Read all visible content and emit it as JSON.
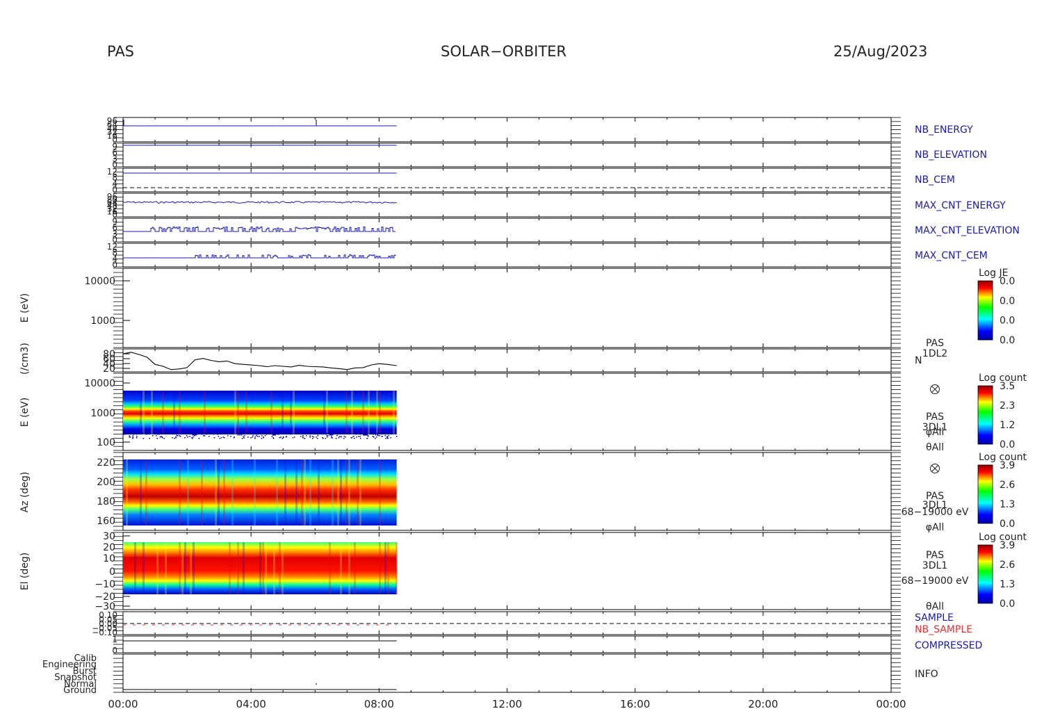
{
  "header": {
    "left": "PAS",
    "center": "SOLAR−ORBITER",
    "right": "25/Aug/2023"
  },
  "colors": {
    "blue_trace": "#1a1aa8",
    "red_trace": "#e53030",
    "black": "#000000"
  },
  "x_axis": {
    "ticks": [
      "00:00",
      "04:00",
      "08:00",
      "12:00",
      "16:00",
      "20:00",
      "00:00"
    ],
    "range_hours": [
      0,
      24
    ],
    "data_end_hours": 8.55
  },
  "strip_labels": {
    "nb_energy": "NB_ENERGY",
    "nb_elevation": "NB_ELEVATION",
    "nb_cem": "NB_CEM",
    "max_cnt_energy": "MAX_CNT_ENERGY",
    "max_cnt_elevation": "MAX_CNT_ELEVATION",
    "max_cnt_cem": "MAX_CNT_CEM",
    "sample": "SAMPLE",
    "nb_sample": "NB_SAMPLE",
    "compressed": "COMPRESSED",
    "info": "INFO"
  },
  "strip_ticks": {
    "nb_energy": [
      "96",
      "64",
      "48",
      "32",
      "16",
      "0"
    ],
    "nb_elevation": [
      "9",
      "6",
      "3",
      "0"
    ],
    "nb_cem": [
      "12",
      "8",
      "4",
      "0"
    ],
    "max_cnt_energy": [
      "96",
      "80",
      "64",
      "48",
      "32",
      "16",
      "0"
    ],
    "max_cnt_elevation": [
      "9",
      "6",
      "3",
      "0"
    ],
    "max_cnt_cem": [
      "12",
      "8",
      "4",
      "0"
    ],
    "sample": [
      "0.10",
      "0.05",
      "0.00",
      "−0.05",
      "−0.10"
    ],
    "compressed": [
      "1",
      "0"
    ],
    "info": [
      "Calib",
      "Engineering",
      "Burst",
      "Snapshot",
      "Normal",
      "Ground"
    ]
  },
  "panels": {
    "energy_je": {
      "ylabel": "E (eV)",
      "yticks": [
        "10000",
        "1000"
      ],
      "cb_title": "Log JE",
      "cb_ticks": [
        "0.0",
        "0.0",
        "0.0",
        "0.0"
      ]
    },
    "density": {
      "ylabel": "(/cm3)",
      "yticks": [
        "80",
        "60",
        "40",
        "20"
      ],
      "label1": "PAS",
      "label2": "1DL2",
      "label3": "N"
    },
    "energy_count": {
      "ylabel": "E (eV)",
      "yticks": [
        "10000",
        "1000",
        "100"
      ],
      "cb_title": "Log count",
      "cb_ticks": [
        "3.5",
        "2.3",
        "1.2",
        "0.0"
      ],
      "lines": [
        "PAS",
        "3DL1",
        "φAll",
        "θAll"
      ]
    },
    "azimuth": {
      "ylabel": "Az (deg)",
      "yticks": [
        "220",
        "200",
        "180",
        "160"
      ],
      "cb_title": "Log count",
      "cb_ticks": [
        "3.9",
        "2.6",
        "1.3",
        "0.0"
      ],
      "lines": [
        "PAS",
        "3DL1",
        "68−19000 eV",
        "φAll"
      ]
    },
    "elevation": {
      "ylabel": "El (deg)",
      "yticks": [
        "30",
        "20",
        "10",
        "0",
        "−10",
        "−20",
        "−30"
      ],
      "cb_title": "Log count",
      "cb_ticks": [
        "3.9",
        "2.6",
        "1.3",
        "0.0"
      ],
      "lines": [
        "PAS",
        "3DL1",
        "68−19000 eV",
        "θAll"
      ]
    }
  },
  "chart_data": {
    "type": "line",
    "title": "SOLAR−ORBITER",
    "xlabel": "",
    "x_range": [
      "00:00",
      "24:00"
    ],
    "series": [
      {
        "name": "N",
        "x_hours": [
          0,
          0.25,
          0.5,
          0.75,
          1.0,
          1.25,
          1.5,
          1.75,
          2.0,
          2.25,
          2.5,
          2.75,
          3.0,
          3.25,
          3.5,
          3.75,
          4.0,
          4.25,
          4.5,
          4.75,
          5.0,
          5.25,
          5.5,
          5.75,
          6.0,
          6.25,
          6.5,
          6.75,
          7.0,
          7.25,
          7.5,
          7.75,
          8.0,
          8.25,
          8.55
        ],
        "values": [
          70,
          75,
          68,
          60,
          38,
          32,
          22,
          24,
          28,
          52,
          56,
          50,
          46,
          48,
          40,
          38,
          36,
          34,
          31,
          34,
          32,
          30,
          35,
          32,
          31,
          30,
          27,
          25,
          22,
          27,
          28,
          36,
          40,
          38,
          34
        ],
        "ylim": [
          15,
          85
        ],
        "ylabel": "(/cm3)"
      }
    ],
    "spectrograms": [
      {
        "name": "E (eV)",
        "y_range": [
          100,
          10000
        ],
        "colorbar": "Log count",
        "c_range": [
          0.0,
          3.5
        ]
      },
      {
        "name": "Az (deg)",
        "y_range": [
          150,
          230
        ],
        "colorbar": "Log count",
        "c_range": [
          0.0,
          3.9
        ]
      },
      {
        "name": "El (deg)",
        "y_range": [
          -30,
          30
        ],
        "colorbar": "Log count",
        "c_range": [
          0.0,
          3.9
        ]
      }
    ]
  }
}
